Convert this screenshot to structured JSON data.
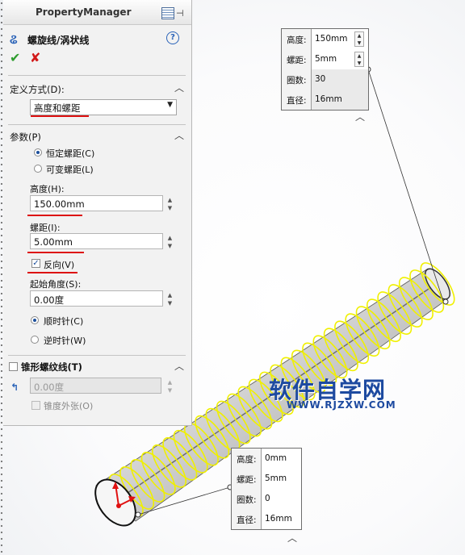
{
  "panel": {
    "title": "PropertyManager",
    "feature_title": "螺旋线/涡状线",
    "help_icon": "?",
    "ok_icon": "✔",
    "cancel_icon": "✘",
    "define_section": "定义方式(D):",
    "define_value": "高度和螺距",
    "params_section": "参数(P)",
    "pitch_mode_options": [
      "恒定螺距(C)",
      "可变螺距(L)"
    ],
    "pitch_mode_selected": 0,
    "height_label": "高度(H):",
    "height_value": "150.00mm",
    "pitch_label": "螺距(I):",
    "pitch_value": "5.00mm",
    "reverse_label": "反向(V)",
    "reverse_checked": true,
    "start_angle_label": "起始角度(S):",
    "start_angle_value": "0.00度",
    "direction_options": [
      "顺时针(C)",
      "逆时针(W)"
    ],
    "direction_selected": 0,
    "taper_section": "锥形螺纹线(T)",
    "taper_checked": false,
    "taper_angle_value": "0.00度",
    "taper_outward_label": "锥度外张(O)",
    "taper_outward_checked": false
  },
  "callout_top": {
    "rows": [
      {
        "key": "高度:",
        "value": "150mm"
      },
      {
        "key": "螺距:",
        "value": "5mm"
      },
      {
        "key": "圈数:",
        "value": "30"
      },
      {
        "key": "直径:",
        "value": "16mm"
      }
    ]
  },
  "callout_bottom": {
    "rows": [
      {
        "key": "高度:",
        "value": "0mm"
      },
      {
        "key": "螺距:",
        "value": "5mm"
      },
      {
        "key": "圈数:",
        "value": "0"
      },
      {
        "key": "直径:",
        "value": "16mm"
      }
    ]
  },
  "watermark": {
    "title": "软件自学网",
    "url": "WWW.RJZXW.COM"
  },
  "colors": {
    "helix": "#f0f000",
    "cylinder": "#c9c9c9",
    "accent_red": "#d11111",
    "watermark": "#1d4aa0"
  }
}
